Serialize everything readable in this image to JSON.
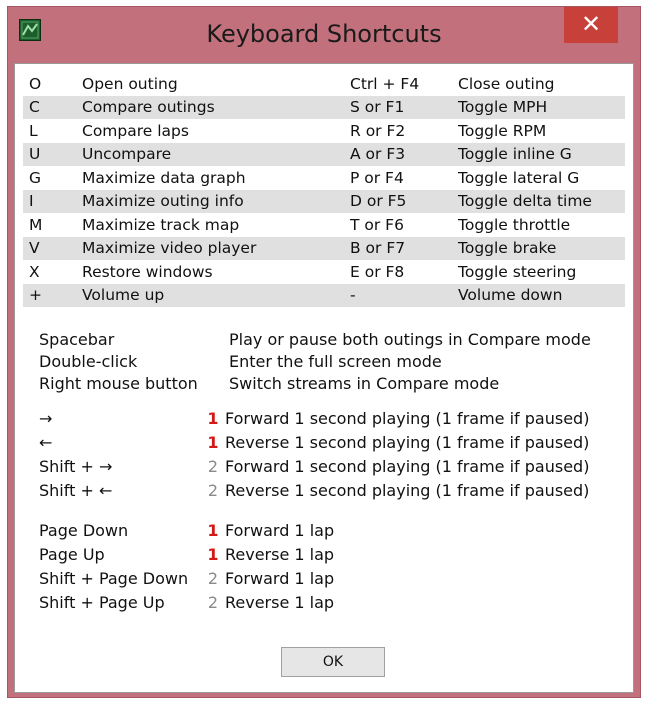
{
  "window": {
    "title": "Keyboard Shortcuts",
    "close_glyph": "✕",
    "icon": "app-logo-icon"
  },
  "shortcuts": [
    {
      "key": "O",
      "action": "Open outing",
      "key2": "Ctrl + F4",
      "action2": "Close outing"
    },
    {
      "key": "C",
      "action": "Compare outings",
      "key2": "S or F1",
      "action2": "Toggle MPH"
    },
    {
      "key": "L",
      "action": "Compare laps",
      "key2": "R or F2",
      "action2": "Toggle RPM"
    },
    {
      "key": "U",
      "action": "Uncompare",
      "key2": "A or F3",
      "action2": "Toggle inline G"
    },
    {
      "key": "G",
      "action": "Maximize data graph",
      "key2": "P or F4",
      "action2": "Toggle lateral G"
    },
    {
      "key": "I",
      "action": "Maximize outing info",
      "key2": "D or F5",
      "action2": "Toggle delta time"
    },
    {
      "key": "M",
      "action": "Maximize track map",
      "key2": "T or F6",
      "action2": "Toggle throttle"
    },
    {
      "key": "V",
      "action": "Maximize video player",
      "key2": "B or F7",
      "action2": "Toggle brake"
    },
    {
      "key": "X",
      "action": "Restore windows",
      "key2": "E or F8",
      "action2": "Toggle steering"
    },
    {
      "key": "+",
      "action": "Volume up",
      "key2": "-",
      "action2": "Volume down"
    }
  ],
  "mouse": [
    {
      "key": "Spacebar",
      "desc": "Play or pause both outings in Compare mode"
    },
    {
      "key": "Double-click",
      "desc": "Enter the full screen mode"
    },
    {
      "key": "Right mouse button",
      "desc": "Switch streams in Compare mode"
    }
  ],
  "seek": [
    {
      "key": "→",
      "marker": "1",
      "marker_color": "red",
      "desc": "Forward 1 second playing (1 frame if paused)"
    },
    {
      "key": "←",
      "marker": "1",
      "marker_color": "red",
      "desc": "Reverse 1 second playing (1 frame if paused)"
    },
    {
      "key": "Shift + →",
      "marker": "2",
      "marker_color": "gray",
      "desc": "Forward 1 second playing (1 frame if paused)"
    },
    {
      "key": "Shift + ←",
      "marker": "2",
      "marker_color": "gray",
      "desc": "Reverse 1 second playing (1 frame if paused)"
    }
  ],
  "laps": [
    {
      "key": "Page Down",
      "marker": "1",
      "marker_color": "red",
      "desc": "Forward 1 lap"
    },
    {
      "key": "Page Up",
      "marker": "1",
      "marker_color": "red",
      "desc": "Reverse 1 lap"
    },
    {
      "key": "Shift + Page Down",
      "marker": "2",
      "marker_color": "gray",
      "desc": "Forward 1 lap"
    },
    {
      "key": "Shift + Page Up",
      "marker": "2",
      "marker_color": "gray",
      "desc": "Reverse 1 lap"
    }
  ],
  "ok_label": "OK",
  "colors": {
    "frame": "#c2707c",
    "close_button": "#c8403a",
    "stripe": "#e0e0e0",
    "marker_red": "#d41818",
    "marker_gray": "#8a8a8a"
  }
}
